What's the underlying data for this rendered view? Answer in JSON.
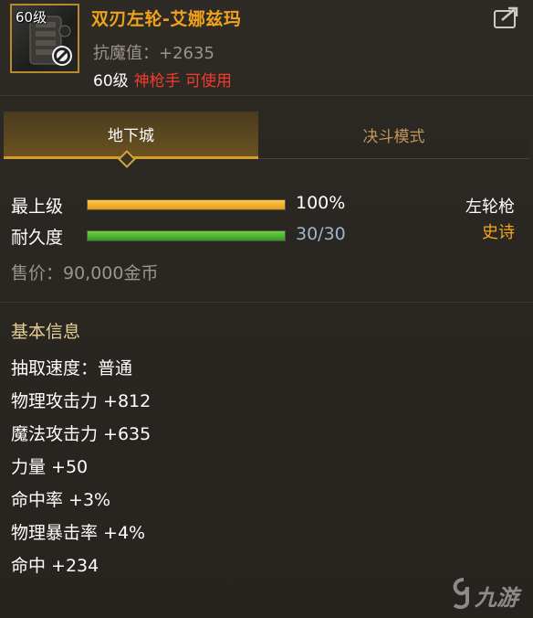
{
  "item": {
    "slot_level": "60级",
    "name": "双刃左轮-艾娜兹玛",
    "magic_resist": "抗魔值：+2635",
    "req_level": "60级",
    "req_class": "神枪手 可使用"
  },
  "tabs": [
    {
      "label": "地下城",
      "active": true
    },
    {
      "label": "决斗模式",
      "active": false
    }
  ],
  "bars": {
    "max_level_label": "最上级",
    "max_level_value": "100%",
    "max_level_fraction": 1.0,
    "durability_label": "耐久度",
    "durability_value": "30/30",
    "durability_fraction": 1.0
  },
  "weapon_type": "左轮枪",
  "rarity": "史诗",
  "price": "售价：90,000金币",
  "basic_info": {
    "title": "基本信息",
    "stats": [
      "抽取速度：普通",
      "物理攻击力 +812",
      "魔法攻击力 +635",
      "力量 +50",
      "命中率 +3%",
      "物理暴击率 +4%",
      "命中 +234"
    ]
  },
  "watermark": "九游",
  "colors": {
    "item_name": "#f0a21c",
    "epic": "#f2a51f",
    "class_req": "#f23b2f",
    "tab_active_border": "#d39c2c"
  }
}
